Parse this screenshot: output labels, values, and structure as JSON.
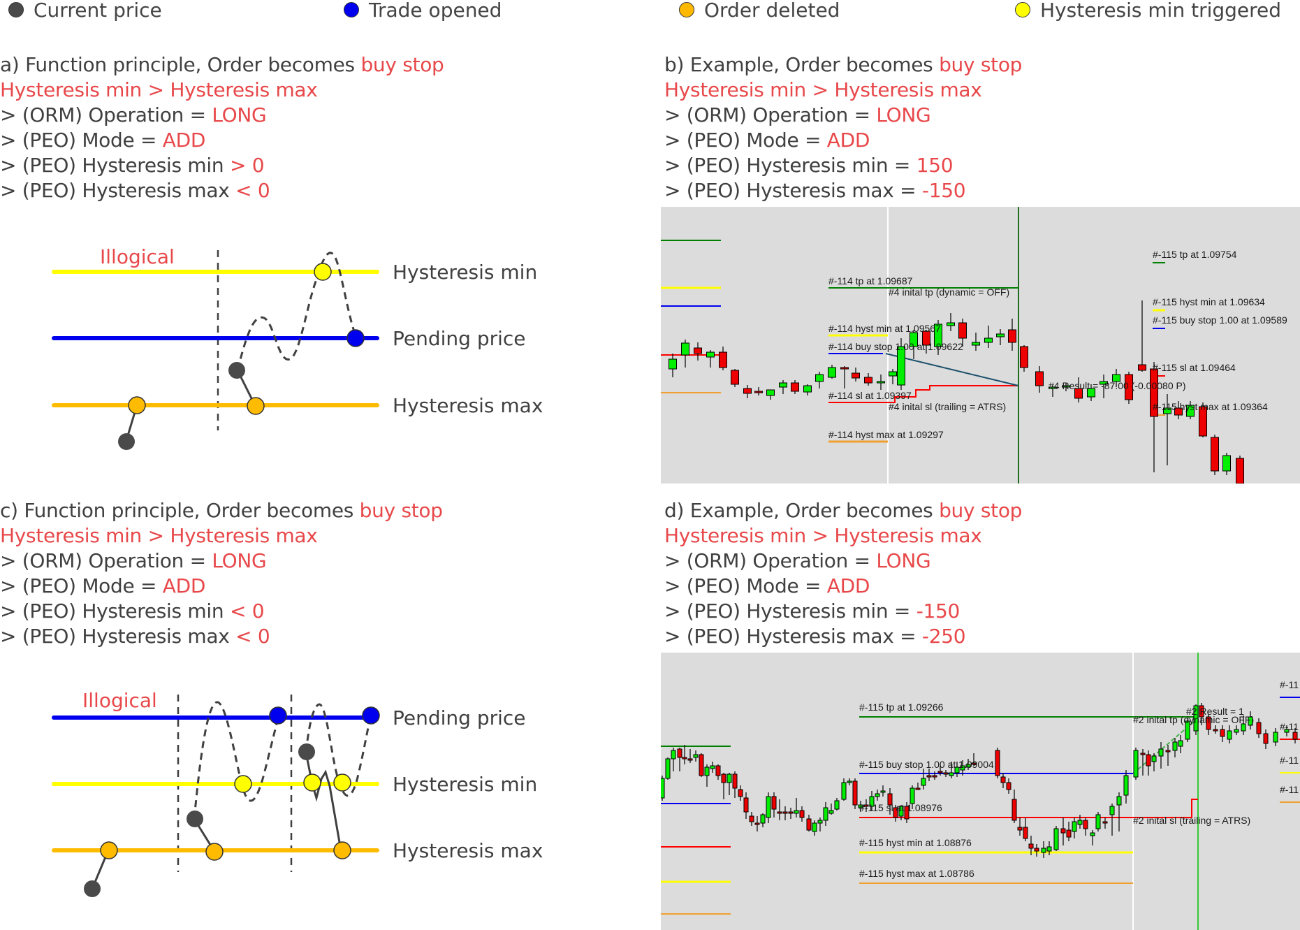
{
  "legend": [
    {
      "label": "Current price",
      "color": "#4a4a4a",
      "icon": "current-price-dot-icon"
    },
    {
      "label": "Trade opened",
      "color": "#0000ee",
      "icon": "trade-opened-dot-icon"
    },
    {
      "label": "Order deleted",
      "color": "#ffb800",
      "icon": "order-deleted-dot-icon"
    },
    {
      "label": "Hysteresis min triggered",
      "color": "#ffff00",
      "icon": "hysteresis-min-triggered-dot-icon"
    }
  ],
  "colors": {
    "accent_red": "#e8484a",
    "text": "#404040",
    "hysteresis_min": "#ffff00",
    "pending_price": "#0000ee",
    "hysteresis_max": "#ffbb00",
    "current_price": "#4a4a4a",
    "chart_bg": "#dcdcdc",
    "candle_up": "#00ee00",
    "candle_down": "#ee0000",
    "tp_line": "#008000",
    "sl_line": "#ff0000"
  },
  "panels": {
    "a": {
      "title_prefix": "a) Function principle, Order becomes ",
      "title_highlight": "buy stop",
      "condition": "Hysteresis min > Hysteresis max",
      "params": [
        {
          "label": "> (ORM) Operation = ",
          "value": "LONG"
        },
        {
          "label": "> (PEO) Mode = ",
          "value": "ADD"
        },
        {
          "label": "> (PEO) Hysteresis min ",
          "value": "> 0"
        },
        {
          "label": "> (PEO) Hysteresis max ",
          "value": "< 0"
        }
      ],
      "diagram": {
        "illogical_label": "Illogical",
        "lines": [
          {
            "label": "Hysteresis min",
            "kind": "hysteresis_min"
          },
          {
            "label": "Pending price",
            "kind": "pending_price"
          },
          {
            "label": "Hysteresis max",
            "kind": "hysteresis_max"
          }
        ]
      }
    },
    "b": {
      "title_prefix": "b) Example, Order becomes ",
      "title_highlight": "buy stop",
      "condition": "Hysteresis min > Hysteresis max",
      "params": [
        {
          "label": "> (ORM) Operation = ",
          "value": "LONG"
        },
        {
          "label": "> (PEO) Mode = ",
          "value": "ADD"
        },
        {
          "label": "> (PEO) Hysteresis min = ",
          "value": "150"
        },
        {
          "label": "> (PEO) Hysteresis max = ",
          "value": "-150"
        }
      ],
      "chart_labels": {
        "tp114": "#-114 tp at 1.09687",
        "init_tp4": "#4 inital tp (dynamic = OFF)",
        "hystmin114": "#-114 hyst min at 1.09567",
        "buystop114": "#-114 buy stop 1.00 at 1.09622",
        "sl114": "#-114 sl at 1.09397",
        "init_sl4": "#4 inital sl (trailing = ATRS)",
        "hystmax114": "#-114 hyst max at 1.09297",
        "result4": "#4 Result = -87.00 (-0.00080 P)",
        "tp115": "#-115 tp at 1.09754",
        "hystmin115": "#-115 hyst min at 1.09634",
        "buystop115": "#-115 buy stop 1.00 at 1.09589",
        "sl115": "#-115 sl at 1.09464",
        "hystmax115": "#-115 hyst max at 1.09364"
      }
    },
    "c": {
      "title_prefix": "c) Function principle, Order becomes ",
      "title_highlight": "buy stop",
      "condition": "Hysteresis min > Hysteresis max",
      "params": [
        {
          "label": "> (ORM) Operation = ",
          "value": "LONG"
        },
        {
          "label": "> (PEO) Mode = ",
          "value": "ADD"
        },
        {
          "label": "> (PEO) Hysteresis min ",
          "value": "< 0"
        },
        {
          "label": "> (PEO) Hysteresis max ",
          "value": "< 0"
        }
      ],
      "diagram": {
        "illogical_label": "Illogical",
        "lines": [
          {
            "label": "Pending price",
            "kind": "pending_price"
          },
          {
            "label": "Hysteresis min",
            "kind": "hysteresis_min"
          },
          {
            "label": "Hysteresis max",
            "kind": "hysteresis_max"
          }
        ]
      }
    },
    "d": {
      "title_prefix": "d) Example, Order becomes ",
      "title_highlight": "buy stop",
      "condition": "Hysteresis min > Hysteresis max",
      "params": [
        {
          "label": "> (ORM) Operation = ",
          "value": "LONG"
        },
        {
          "label": "> (PEO) Mode = ",
          "value": "ADD"
        },
        {
          "label": "> (PEO) Hysteresis min = ",
          "value": "-150"
        },
        {
          "label": "> (PEO) Hysteresis max = ",
          "value": "-250"
        }
      ],
      "chart_labels": {
        "tp115": "#-115 tp at 1.09266",
        "buystop115": "#-115 buy stop 1.00 at 1.09004",
        "sl115": "#-115 sl at 1.08976",
        "hystmin115": "#-115 hyst min at 1.08876",
        "hystmax115": "#-115 hyst max at 1.08786",
        "init_tp2": "#2 inital tp (dynamic = OFF)",
        "result2": "#2 Result = 1",
        "init_sl2": "#2 inital sl (trailing = ATRS)",
        "cut_label": "#-11"
      }
    }
  }
}
